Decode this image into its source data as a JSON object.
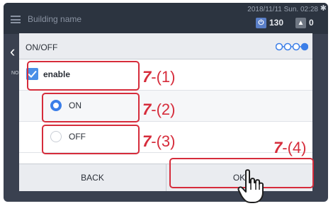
{
  "header": {
    "building_name": "Building name",
    "datetime": "2018/11/11 Sun. 02:28",
    "power_count": "130",
    "alarm_count": "0"
  },
  "side": {
    "text": "NO"
  },
  "dialog": {
    "title": "ON/OFF",
    "enable_label": "enable",
    "on_label": "ON",
    "off_label": "OFF",
    "back_label": "BACK",
    "ok_label": "OK"
  },
  "annotations": {
    "a1": {
      "num": "7",
      "suffix": "-(1)"
    },
    "a2": {
      "num": "7",
      "suffix": "-(2)"
    },
    "a3": {
      "num": "7",
      "suffix": "-(3)"
    },
    "a4": {
      "num": "7",
      "suffix": "-(4)"
    }
  },
  "colors": {
    "accent": "#3b7ee8",
    "annotation": "#d62c3b",
    "background": "#3a4150"
  },
  "icons": [
    "menu-icon",
    "gear-icon",
    "power-icon",
    "alarm-icon",
    "chevron-left-icon",
    "step-progress-icon",
    "checkmark-icon",
    "hand-pointer-icon"
  ]
}
